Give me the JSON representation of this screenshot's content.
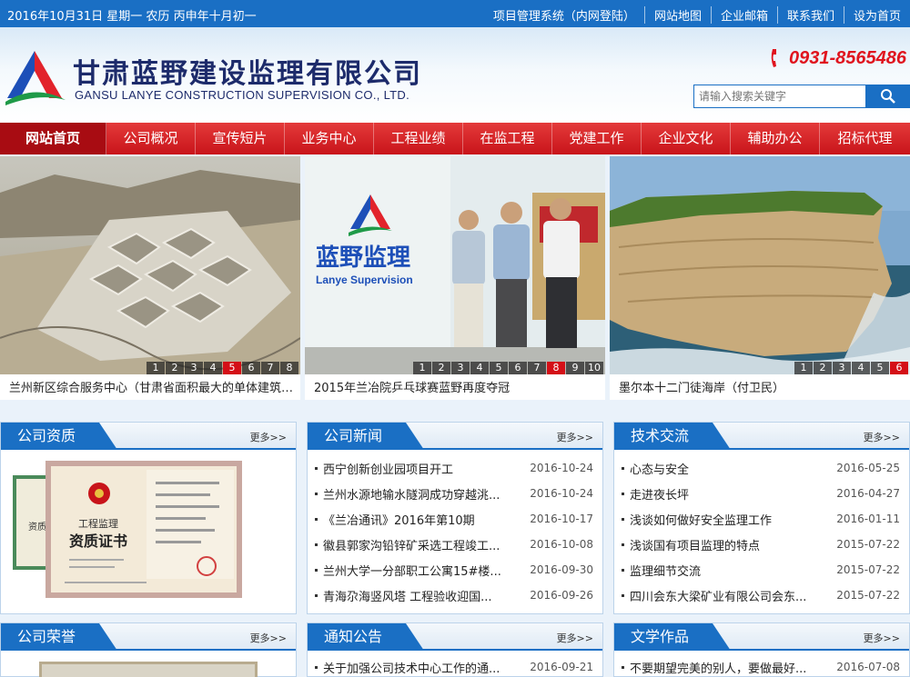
{
  "topbar": {
    "date": "2016年10月31日 星期一 农历 丙申年十月初一",
    "links": [
      "项目管理系统（内网登陆）",
      "网站地图",
      "企业邮箱",
      "联系我们",
      "设为首页"
    ]
  },
  "header": {
    "company_cn": "甘肃蓝野建设监理有限公司",
    "company_en": "GANSU LANYE CONSTRUCTION SUPERVISION CO., LTD.",
    "phone": "0931-8565486",
    "search_placeholder": "请输入搜索关键字"
  },
  "nav": {
    "items": [
      "网站首页",
      "公司概况",
      "宣传短片",
      "业务中心",
      "工程业绩",
      "在监工程",
      "党建工作",
      "企业文化",
      "辅助办公",
      "招标代理"
    ],
    "active_index": 0
  },
  "banner": {
    "slides": [
      {
        "caption": "兰州新区综合服务中心（甘肃省面积最大的单体建筑-建...",
        "pages": [
          "1",
          "2",
          "3",
          "4",
          "5",
          "6",
          "7",
          "8"
        ],
        "active_page": "5"
      },
      {
        "caption": "2015年兰冶院乒乓球赛蓝野再度夺冠",
        "pages": [
          "1",
          "2",
          "3",
          "4",
          "5",
          "6",
          "7",
          "8",
          "9",
          "10"
        ],
        "active_page": "8",
        "sign_cn": "蓝野监理",
        "sign_en": "Lanye Supervision"
      },
      {
        "caption": "墨尔本十二门徒海岸（付卫民）",
        "pages": [
          "1",
          "2",
          "3",
          "4",
          "5",
          "6"
        ],
        "active_page": "6"
      }
    ]
  },
  "sections": {
    "qualification": {
      "title": "公司资质",
      "more": "更多>>",
      "cert_title_1": "工程监理",
      "cert_title_2": "资质证书",
      "cert_small": "资质证书"
    },
    "news": {
      "title": "公司新闻",
      "more": "更多>>",
      "items": [
        {
          "title": "西宁创新创业园项目开工",
          "date": "2016-10-24"
        },
        {
          "title": "兰州水源地输水隧洞成功穿越洮...",
          "date": "2016-10-24"
        },
        {
          "title": "《兰冶通讯》2016年第10期",
          "date": "2016-10-17"
        },
        {
          "title": "徽县郭家沟铅锌矿采选工程竣工...",
          "date": "2016-10-08"
        },
        {
          "title": "兰州大学一分部职工公寓15#楼...",
          "date": "2016-09-30"
        },
        {
          "title": "青海尕海竖风塔 工程验收迎国...",
          "date": "2016-09-26"
        }
      ]
    },
    "tech": {
      "title": "技术交流",
      "more": "更多>>",
      "items": [
        {
          "title": "心态与安全",
          "date": "2016-05-25"
        },
        {
          "title": "走进夜长坪",
          "date": "2016-04-27"
        },
        {
          "title": "浅谈如何做好安全监理工作",
          "date": "2016-01-11"
        },
        {
          "title": "浅谈国有项目监理的特点",
          "date": "2015-07-22"
        },
        {
          "title": "监理细节交流",
          "date": "2015-07-22"
        },
        {
          "title": "四川会东大梁矿业有限公司会东...",
          "date": "2015-07-22"
        }
      ]
    },
    "honor": {
      "title": "公司荣誉",
      "more": "更多>>"
    },
    "notice": {
      "title": "通知公告",
      "more": "更多>>",
      "items": [
        {
          "title": "关于加强公司技术中心工作的通...",
          "date": "2016-09-21"
        }
      ]
    },
    "literature": {
      "title": "文学作品",
      "more": "更多>>",
      "items": [
        {
          "title": "不要期望完美的别人，要做最好...",
          "date": "2016-07-08"
        }
      ]
    }
  },
  "colors": {
    "brand_blue": "#1a6fc4",
    "nav_red": "#c8141a",
    "phone_red": "#e0141e",
    "pager_active": "#d40f17"
  }
}
